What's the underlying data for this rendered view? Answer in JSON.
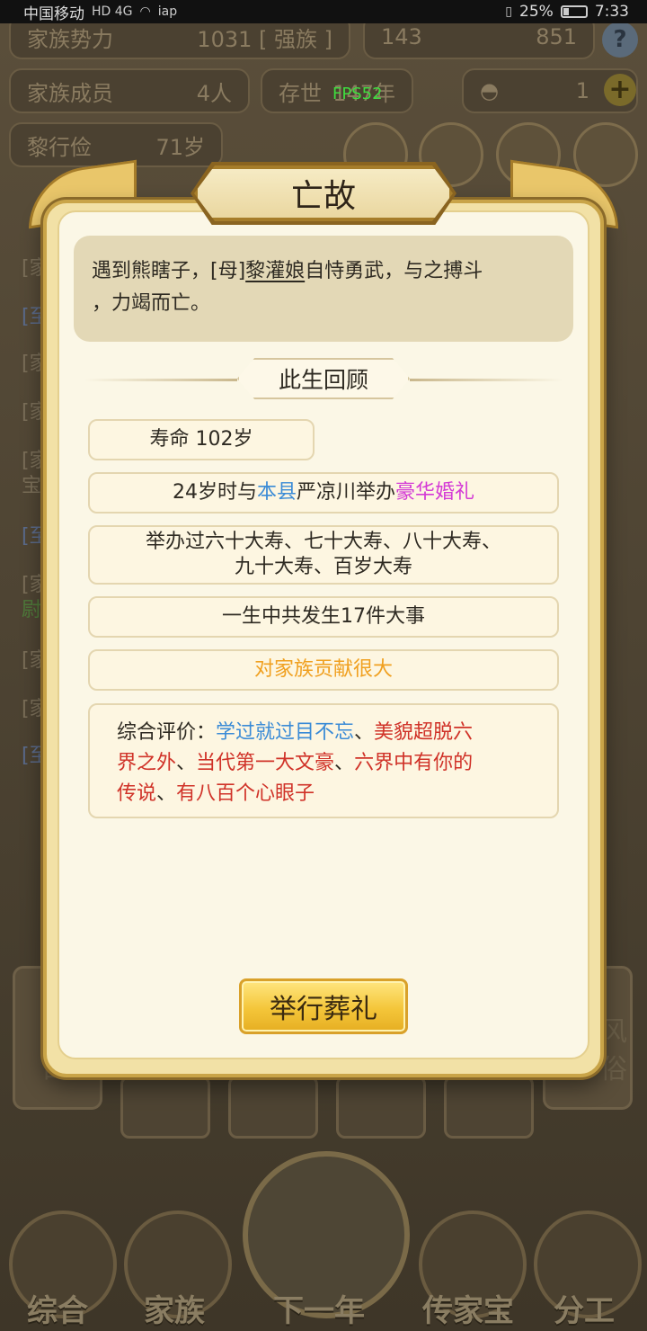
{
  "status_bar": {
    "carrier": "中国移动",
    "carrier_icons": "HD 4G",
    "extra_icon": "iap",
    "battery": "25%",
    "time": "7:33"
  },
  "background": {
    "family_power_label": "家族势力",
    "family_power_value": "1031 [ 强族 ]",
    "currency_1": "143",
    "currency_2": "851",
    "members_label": "家族成员",
    "members_value": "4人",
    "era_label": "存世",
    "era_value": "147年",
    "gold_value": "1",
    "elder_name": "黎行俭",
    "elder_age": "71岁",
    "fps": "FPS52",
    "log_prefixes": [
      "[家",
      "[至",
      "[家",
      "[家",
      "[家",
      "宝",
      "[至",
      "[家",
      "尉",
      "[家",
      "[家",
      "[至"
    ],
    "right_text_1": "风",
    "right_text_2": "俗",
    "left_text": "四"
  },
  "dialog": {
    "title": "亡故",
    "death_text_1": "遇到熊瞎子，[母]",
    "death_name": "黎灌娘",
    "death_text_2": "自恃勇武，与之搏斗",
    "death_text_3": "，力竭而亡。",
    "review_heading": "此生回顾",
    "lifespan": "寿命 102岁",
    "wedding_1": "24岁时与",
    "wedding_place": "本县",
    "wedding_2": "严凉川举办",
    "wedding_type": "豪华婚礼",
    "birthdays_1": "举办过六十大寿、七十大寿、八十大寿、",
    "birthdays_2": "九十大寿、百岁大寿",
    "events": "一生中共发生17件大事",
    "contribution": "对家族贡献很大",
    "eval_label": "综合评价：",
    "eval_trait_1": "学过就过目不忘",
    "eval_sep": "、",
    "eval_trait_2a": "美貌超脱六",
    "eval_trait_2b": "界之外",
    "eval_trait_3": "当代第一大文豪",
    "eval_trait_4": "六界中有你的",
    "eval_trait_4b": "传说",
    "eval_trait_5": "有八百个心眼子",
    "funeral_button": "举行葬礼"
  },
  "bottom_nav": {
    "items": [
      "综合",
      "家族",
      "下一年",
      "传家宝",
      "分工"
    ]
  },
  "colors": {
    "highlight_blue": "#3a8bd6",
    "highlight_pink": "#d43ad6",
    "highlight_orange": "#f0a020",
    "highlight_red": "#d03228",
    "gold_button": "#f4c63a"
  }
}
